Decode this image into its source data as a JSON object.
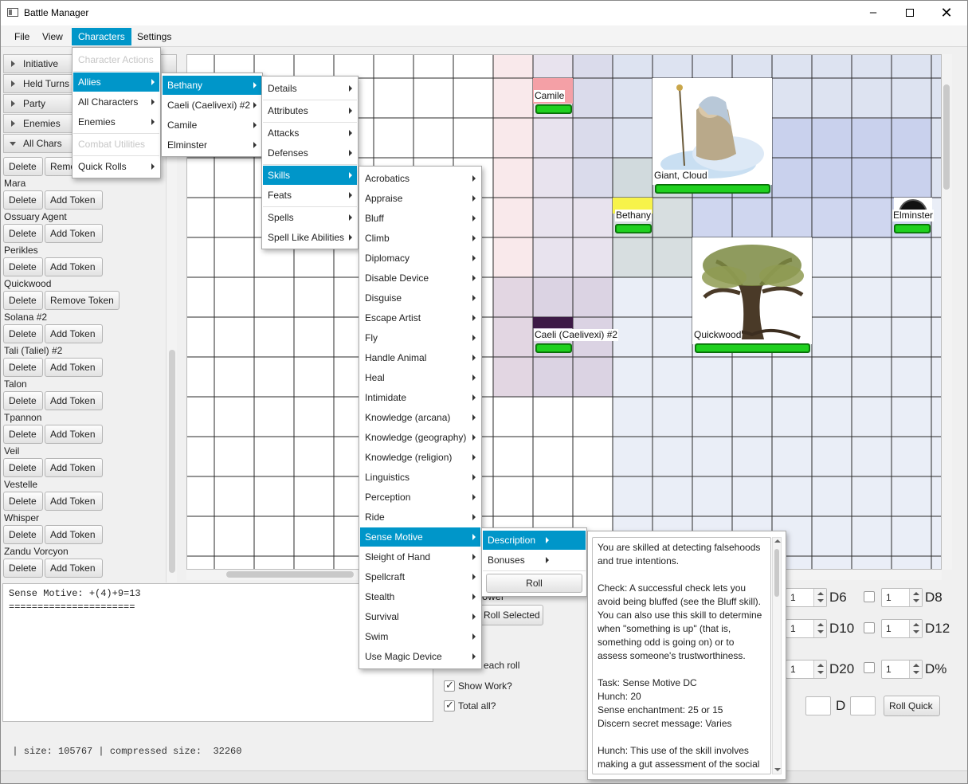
{
  "window": {
    "title": "Battle Manager"
  },
  "menubar": [
    "File",
    "View",
    "Characters",
    "Settings"
  ],
  "sidebar": {
    "headers": [
      "Initiative",
      "Held Turns",
      "Party",
      "Enemies",
      "All Chars"
    ],
    "first_row_buttons": [
      "Delete",
      "Remo"
    ],
    "characters": [
      {
        "name": "Mara",
        "action": "Add Token"
      },
      {
        "name": "Ossuary Agent",
        "action": "Add Token"
      },
      {
        "name": "Perikles",
        "action": "Add Token"
      },
      {
        "name": "Quickwood",
        "action": "Remove Token"
      },
      {
        "name": "Solana #2",
        "action": "Add Token"
      },
      {
        "name": "Tali (Taliel) #2",
        "action": "Add Token"
      },
      {
        "name": "Talon",
        "action": "Add Token"
      },
      {
        "name": "Tpannon",
        "action": "Add Token"
      },
      {
        "name": "Veil",
        "action": "Add Token"
      },
      {
        "name": "Vestelle",
        "action": "Add Token"
      },
      {
        "name": "Whisper",
        "action": "Add Token"
      },
      {
        "name": "Zandu Vorcyon",
        "action": "Add Token"
      }
    ],
    "delete_label": "Delete"
  },
  "map": {
    "tokens": [
      {
        "name": "Camile",
        "color": "#f4a0a6"
      },
      {
        "name": "Giant, Cloud"
      },
      {
        "name": "Bethany",
        "color": "#f7f34a"
      },
      {
        "name": "Elminster"
      },
      {
        "name": "Caeli (Caelivexi) #2",
        "color": "#3d1a46"
      },
      {
        "name": "Quickwood"
      }
    ]
  },
  "output": {
    "lines": [
      "Sense Motive: +(4)+9=13",
      "======================"
    ]
  },
  "dice": {
    "roll_selected": "Roll Selected",
    "each_roll": "each roll",
    "partial_label": "ower",
    "show_work": "Show Work?",
    "total_all": "Total all?",
    "dice": [
      {
        "label": "D6",
        "value": "1"
      },
      {
        "label": "D8",
        "value": "1"
      },
      {
        "label": "D10",
        "value": "1"
      },
      {
        "label": "D12",
        "value": "1"
      },
      {
        "label": "D20",
        "value": "1"
      },
      {
        "label": "D%",
        "value": "1"
      }
    ],
    "d_label": "D",
    "roll_quick": "Roll Quick"
  },
  "menus": {
    "characters": {
      "items": [
        "Character Actions",
        "Allies",
        "All Characters",
        "Enemies",
        "Combat Utilities",
        "Quick Rolls"
      ]
    },
    "allies": {
      "items": [
        "Bethany",
        "Caeli (Caelivexi) #2",
        "Camile",
        "Elminster"
      ]
    },
    "bethany": {
      "items": [
        "Details",
        "Attributes",
        "Attacks",
        "Defenses",
        "Skills",
        "Feats",
        "Spells",
        "Spell Like Abilities"
      ]
    },
    "skills": {
      "items": [
        "Acrobatics",
        "Appraise",
        "Bluff",
        "Climb",
        "Diplomacy",
        "Disable Device",
        "Disguise",
        "Escape Artist",
        "Fly",
        "Handle Animal",
        "Heal",
        "Intimidate",
        "Knowledge (arcana)",
        "Knowledge (geography)",
        "Knowledge (religion)",
        "Linguistics",
        "Perception",
        "Ride",
        "Sense Motive",
        "Sleight of Hand",
        "Spellcraft",
        "Stealth",
        "Survival",
        "Swim",
        "Use Magic Device"
      ]
    },
    "sense_motive": {
      "items": [
        "Description",
        "Bonuses"
      ],
      "roll": "Roll"
    }
  },
  "description": {
    "text": "You are skilled at detecting falsehoods and true intentions.\n\nCheck: A successful check lets you avoid being bluffed (see the Bluff skill). You can also use this skill to determine when \"something is up\" (that is, something odd is going on) or to assess someone's trustworthiness.\n\nTask: Sense Motive DC\nHunch: 20\nSense enchantment: 25 or 15\nDiscern secret message: Varies\n\nHunch: This use of the skill involves making a gut assessment of the social situation. You can get the feeling from"
  },
  "background_text": "  | size: 105767 | compressed size:  32260"
}
